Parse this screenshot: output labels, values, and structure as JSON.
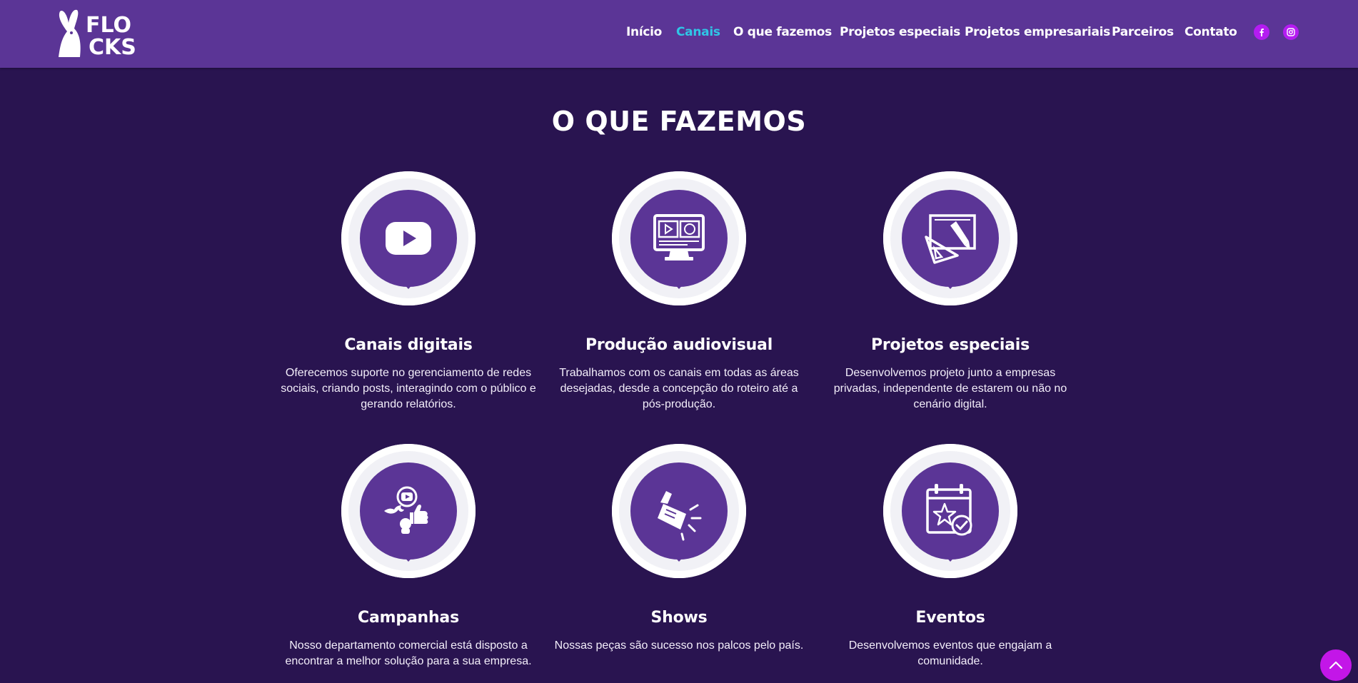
{
  "brand": {
    "logo_text_top": "FLO",
    "logo_text_bottom": "CKS"
  },
  "nav": {
    "items": [
      {
        "label": "Início",
        "active": false
      },
      {
        "label": "Canais",
        "active": true
      },
      {
        "label": "O que fazemos",
        "active": false
      },
      {
        "label": "Projetos especiais",
        "active": false
      },
      {
        "label": "Projetos empresariais",
        "active": false
      },
      {
        "label": "Parceiros",
        "active": false
      },
      {
        "label": "Contato",
        "active": false
      }
    ],
    "social": [
      {
        "icon": "facebook-icon"
      },
      {
        "icon": "instagram-icon"
      }
    ]
  },
  "section": {
    "title": "O QUE FAZEMOS",
    "cards": [
      {
        "icon": "youtube-play-icon",
        "title": "Canais digitais",
        "text": "Oferecemos suporte no gerenciamento de redes sociais, criando posts, interagindo com o público e gerando relatórios."
      },
      {
        "icon": "video-editing-monitor-icon",
        "title": "Produção audiovisual",
        "text": "Trabalhamos com os canais em todas as áreas desejadas, desde a concepção do roteiro até a pós-produção."
      },
      {
        "icon": "design-tools-icon",
        "title": "Projetos especiais",
        "text": "Desenvolvemos projeto junto a empresas privadas, independente de estarem ou não no cenário digital."
      },
      {
        "icon": "social-media-campaign-icon",
        "title": "Campanhas",
        "text": "Nosso departamento comercial está disposto a encontrar a melhor solução para a sua empresa."
      },
      {
        "icon": "stage-spotlight-icon",
        "title": "Shows",
        "text": "Nossas peças são sucesso nos palcos pelo país."
      },
      {
        "icon": "event-calendar-icon",
        "title": "Eventos",
        "text": "Desenvolvemos eventos que engajam a comunidade."
      }
    ]
  },
  "colors": {
    "header_bg": "#5b3596",
    "page_bg": "#291450",
    "active_nav": "#2fc6e6",
    "accent_magenta": "#c316e8"
  },
  "back_to_top": {
    "icon": "chevron-up-icon"
  }
}
